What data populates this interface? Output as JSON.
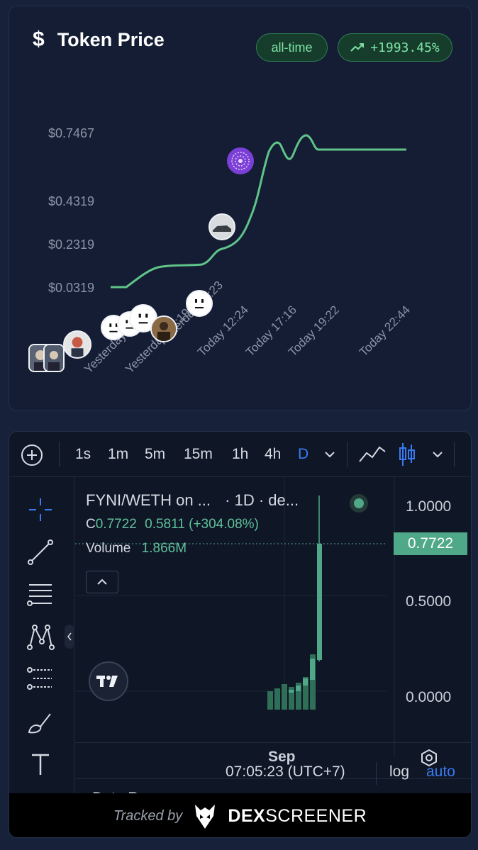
{
  "price_card": {
    "title": "Token Price",
    "range_pill": "all-time",
    "change_pill": "+1993.45%",
    "y_ticks": [
      "$0.7467",
      "$0.4319",
      "$0.2319",
      "$0.0319"
    ],
    "x_ticks": [
      "Yesterday 08:29",
      "Yesterday 11:19",
      "Yesterday 14:23",
      "Today 12:24",
      "Today 17:16",
      "Today 19:22",
      "Today 22:44"
    ],
    "accent_color": "#5fc38a"
  },
  "chart": {
    "timeframes": [
      "1s",
      "1m",
      "5m",
      "15m",
      "1h",
      "4h",
      "D"
    ],
    "active_timeframe": "D",
    "pair_label": "FYNI/WETH on ...",
    "interval_label": "· 1D · de...",
    "close_prefix": "C",
    "close_value": "0.7722",
    "change_text": "0.5811 (+304.08%)",
    "volume_label": "Volume",
    "volume_value": "1.866M",
    "price_scale": [
      "1.0000",
      "0.5000",
      "0.0000"
    ],
    "last_price_tag": "0.7722",
    "x_label": "Sep",
    "date_range_label": "Date Range",
    "time_label": "07:05:23 (UTC+7)",
    "log_label": "log",
    "auto_label": "auto",
    "up_color": "#4fa887"
  },
  "footer": {
    "tracked_by": "Tracked by",
    "brand_bold": "DEX",
    "brand_rest": "SCREENER"
  }
}
